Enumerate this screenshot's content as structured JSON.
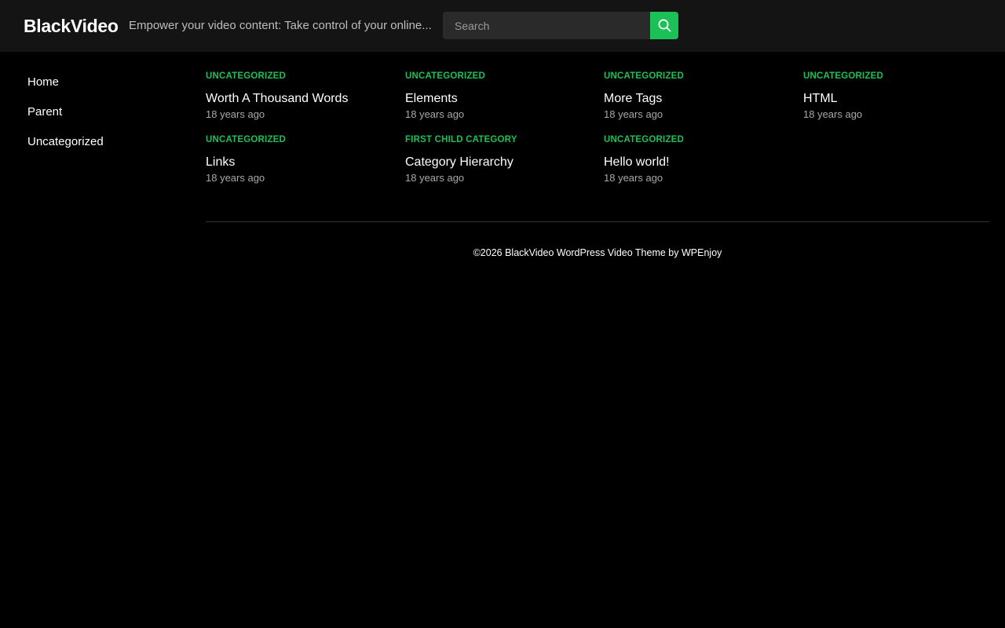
{
  "header": {
    "site_title": "BlackVideo",
    "tagline": "Empower your video content: Take control of your online...",
    "search": {
      "placeholder": "Search",
      "value": ""
    },
    "search_button_icon": "search-icon",
    "accent_color": "#1bc157"
  },
  "sidebar": {
    "items": [
      {
        "label": "Home"
      },
      {
        "label": "Parent"
      },
      {
        "label": "Uncategorized"
      }
    ]
  },
  "posts": [
    {
      "category": "UNCATEGORIZED",
      "title": "Worth A Thousand Words",
      "time": "18 years ago"
    },
    {
      "category": "UNCATEGORIZED",
      "title": "Elements",
      "time": "18 years ago"
    },
    {
      "category": "UNCATEGORIZED",
      "title": "More Tags",
      "time": "18 years ago"
    },
    {
      "category": "UNCATEGORIZED",
      "title": "HTML",
      "time": "18 years ago"
    },
    {
      "category": "UNCATEGORIZED",
      "title": "Links",
      "time": "18 years ago"
    },
    {
      "category": "FIRST CHILD CATEGORY",
      "title": "Category Hierarchy",
      "time": "18 years ago"
    },
    {
      "category": "UNCATEGORIZED",
      "title": "Hello world!",
      "time": "18 years ago"
    }
  ],
  "footer": {
    "copyright": "©2026 BlackVideo WordPress Video Theme by",
    "author_link": "WPEnjoy"
  }
}
